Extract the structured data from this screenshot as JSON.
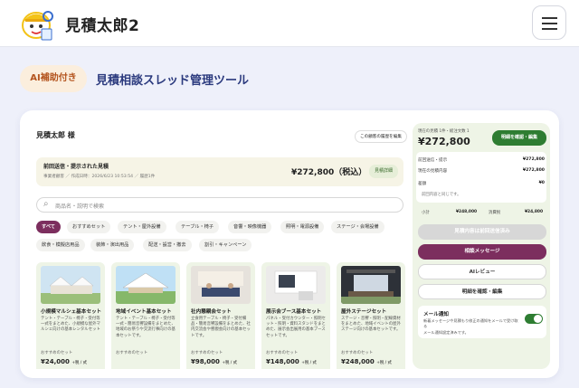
{
  "header": {
    "brand": "見積太郎2",
    "logo_icon": "mascot-character-icon",
    "menu_icon": "hamburger-menu-icon"
  },
  "hero": {
    "badge": "AI補助付き",
    "title": "見積相談スレッド管理ツール"
  },
  "mockup": {
    "customer": "見積太郎 様",
    "customer_button": "この顧客の履歴を編集",
    "previous": {
      "title": "前回送信・提示された見積",
      "meta": "事業者顧客 ／ 作成日時：2026/6/23 10:53:54 ／ 履歴1件",
      "amount": "¥272,800（税込）",
      "detail_button": "見積詳細"
    },
    "search": {
      "placeholder": "商品名・説明で検索",
      "icon": "search-icon"
    },
    "categories": [
      "すべて",
      "おすすめセット",
      "テント・屋外設備",
      "テーブル・椅子",
      "音響・映像機器",
      "照明・電源設備",
      "ステージ・会場設備",
      "飲食・模擬店用品",
      "装飾・演出用品",
      "配送・設営・撤去",
      "割引・キャンペーン"
    ],
    "products": [
      {
        "name": "小規模マルシェ基本セット",
        "desc": "テント・テーブル・椅子・受付等一式をまとめた、小規模な屋外マルシェ向けの基本レンタルセット",
        "rec": "おすすめのセット",
        "price": "¥24,000",
        "unit": "+税 / 式"
      },
      {
        "name": "地域イベント基本セット",
        "desc": "テント・テーブル・椅子・受付等一式・簡易音響設備をまとめた、地域のお祭りや交流行事向けの基本セットです。",
        "rec": "おすすめのセット",
        "price": "",
        "unit": ""
      },
      {
        "name": "社内懇親会セット",
        "desc": "立食用テーブル・椅子・受付備品・簡易音響設備をまとめた、社内交流会や懇親会向けの基本セットです。",
        "rec": "おすすめのセット",
        "price": "¥98,000",
        "unit": "+税 / 式"
      },
      {
        "name": "展示会ブース基本セット",
        "desc": "パネル・受付カウンター・照明セット・照明・資料スタンドをまとめた、展示会出展用の基本ブースセットです。",
        "rec": "おすすめのセット",
        "price": "¥148,000",
        "unit": "+税 / 式"
      },
      {
        "name": "屋外ステージセット",
        "desc": "ステージ・音響・照明・配線資材をまとめた、地域イベントの屋外ステージ向けの基本セットです。",
        "rec": "おすすめのセット",
        "price": "¥248,000",
        "unit": "+税 / 式"
      }
    ]
  },
  "sidebar": {
    "label": "現在の見積 1件・総注文数 1",
    "total": "¥272,800",
    "confirm_button": "明細を確認・編集",
    "rows": [
      {
        "label": "前回送信・提示",
        "value": "¥272,800"
      },
      {
        "label": "現在の見積内容",
        "value": "¥272,800"
      },
      {
        "label": "差額",
        "value": "¥0"
      }
    ],
    "same_note": "前回内容と同じです。",
    "subtotal_label": "小計",
    "subtotal": "¥248,000",
    "tax_label": "消費税",
    "tax": "¥24,800",
    "sent_button": "見積内容は前回送信済み",
    "message_button": "相談メッセージ",
    "ai_button": "AIレビュー",
    "detail_button": "明細を確認・編集",
    "notify_title": "メール通知",
    "notify_text": "新着メッセージや見積もり修正の通知をメールで受け取る",
    "notify_sub": "メール通知設定済みです。"
  },
  "colors": {
    "accent": "#7c2e5e",
    "green": "#2e7d32",
    "brand_blue": "#2b3a7e"
  }
}
